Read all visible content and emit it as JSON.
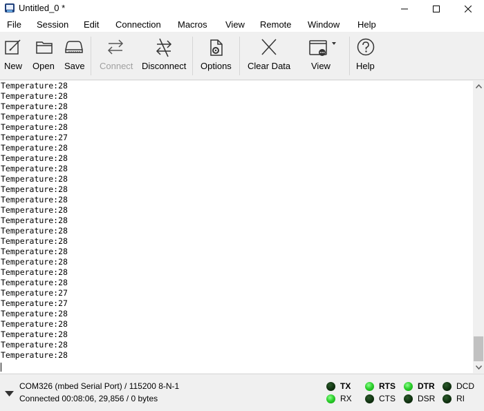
{
  "window": {
    "title": "Untitled_0 *"
  },
  "menu": [
    "File",
    "Session",
    "Edit",
    "Connection",
    "Macros",
    "View",
    "Remote",
    "Window",
    "Help"
  ],
  "toolbar": {
    "new": "New",
    "open": "Open",
    "save": "Save",
    "connect": "Connect",
    "disconnect": "Disconnect",
    "options": "Options",
    "clear": "Clear Data",
    "view": "View",
    "help": "Help"
  },
  "terminal": {
    "lines": [
      "Temperature:28",
      "Temperature:28",
      "Temperature:28",
      "Temperature:28",
      "Temperature:28",
      "Temperature:27",
      "Temperature:28",
      "Temperature:28",
      "Temperature:28",
      "Temperature:28",
      "Temperature:28",
      "Temperature:28",
      "Temperature:28",
      "Temperature:28",
      "Temperature:28",
      "Temperature:28",
      "Temperature:28",
      "Temperature:28",
      "Temperature:28",
      "Temperature:28",
      "Temperature:27",
      "Temperature:27",
      "Temperature:28",
      "Temperature:28",
      "Temperature:28",
      "Temperature:28",
      "Temperature:28"
    ]
  },
  "status": {
    "port": "COM326 (mbed Serial Port) / 115200 8-N-1",
    "connection": "Connected 00:08:06, 29,856 / 0 bytes"
  },
  "signals": {
    "tx": {
      "label": "TX",
      "on": false
    },
    "rx": {
      "label": "RX",
      "on": true
    },
    "rts": {
      "label": "RTS",
      "on": true
    },
    "cts": {
      "label": "CTS",
      "on": false
    },
    "dtr": {
      "label": "DTR",
      "on": true
    },
    "dsr": {
      "label": "DSR",
      "on": false
    },
    "dcd": {
      "label": "DCD",
      "on": false
    },
    "ri": {
      "label": "RI",
      "on": false
    }
  },
  "colors": {
    "led_on": "#2fd12f",
    "led_off": "#0f2f0f",
    "disabled_text": "#a0a0a0"
  }
}
